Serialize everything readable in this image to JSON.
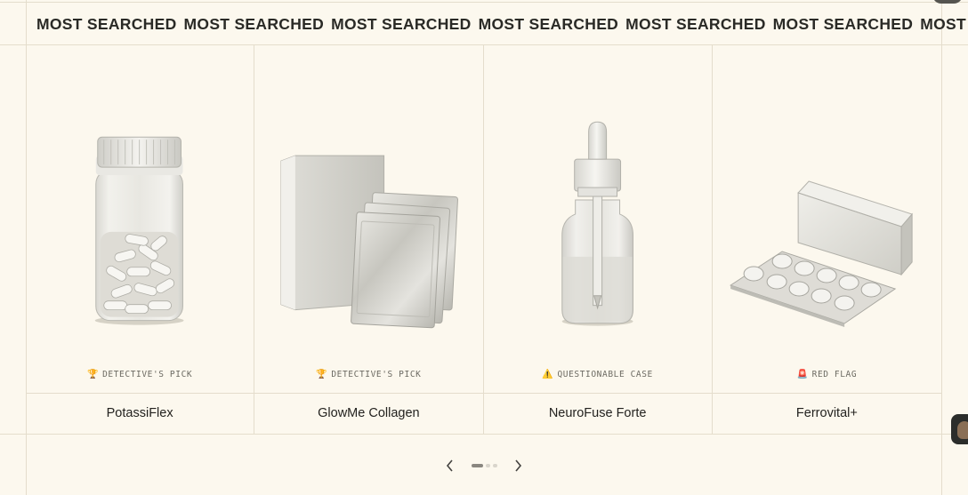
{
  "ticker": {
    "items": [
      "MOST SEARCHED",
      "MOST SEARCHED",
      "MOST SEARCHED",
      "MOST SEARCHED",
      "MOST SEARCHED",
      "MOST SEARCHED",
      "MOST SEARCHED"
    ]
  },
  "products": [
    {
      "name": "PotassiFlex",
      "badge": "DETECTIVE'S PICK",
      "badge_icon": "trophy-icon",
      "badge_emoji": "🏆",
      "image": "capsule-jar-image"
    },
    {
      "name": "GlowMe Collagen",
      "badge": "DETECTIVE'S PICK",
      "badge_icon": "trophy-icon",
      "badge_emoji": "🏆",
      "image": "sachet-box-image"
    },
    {
      "name": "NeuroFuse Forte",
      "badge": "QUESTIONABLE CASE",
      "badge_icon": "warning-icon",
      "badge_emoji": "⚠️",
      "image": "dropper-bottle-image"
    },
    {
      "name": "Ferrovital+",
      "badge": "RED FLAG",
      "badge_icon": "red-flag-icon",
      "badge_emoji": "🚨",
      "image": "blister-pack-image"
    }
  ],
  "pagination": {
    "total_pages": 3,
    "current_page": 1
  },
  "colors": {
    "background": "#fcf8ee",
    "border": "#e4ddcc",
    "text": "#2a2a26",
    "badge_text": "#6c6a62"
  }
}
